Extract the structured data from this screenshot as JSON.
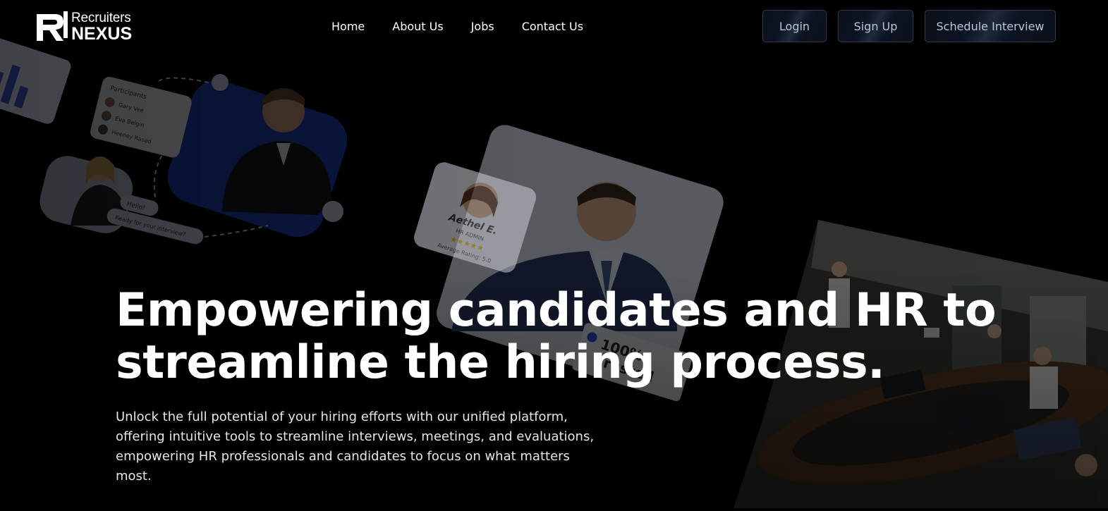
{
  "brand": {
    "name_top": "Recruiters",
    "name_bottom": "NEXUS",
    "logo_icon": "rn-monogram-icon"
  },
  "nav": {
    "home": "Home",
    "about": "About Us",
    "jobs": "Jobs",
    "contact": "Contact Us"
  },
  "actions": {
    "login": "Login",
    "signup": "Sign Up",
    "schedule": "Schedule Interview"
  },
  "hero": {
    "title_line1": "Empowering candidates and HR to",
    "title_line2": "streamline the hiring process.",
    "subtitle": "Unlock the full potential of your hiring efforts with our unified platform, offering intuitive tools to streamline interviews, meetings, and evaluations, empowering HR professionals and candidates to focus on what matters most."
  },
  "illustration": {
    "participants_title": "Participants",
    "participants": [
      "Gary Vee",
      "Eva Belgin",
      "Heeney Rasad"
    ],
    "chat_hello": "Hello!",
    "chat_question": "Ready for your interview?",
    "profile_name": "Aethel E.",
    "profile_role": "HR ADMIN",
    "profile_rating": "Average Rating: 5.0",
    "profile_stars": 5,
    "trusted_value": "100%",
    "trusted_label": "Trusted"
  },
  "colors": {
    "background": "#000000",
    "button_border": "#2f3a4f",
    "button_text": "#b8c4d8",
    "accent_blue": "#1f3fb4"
  }
}
